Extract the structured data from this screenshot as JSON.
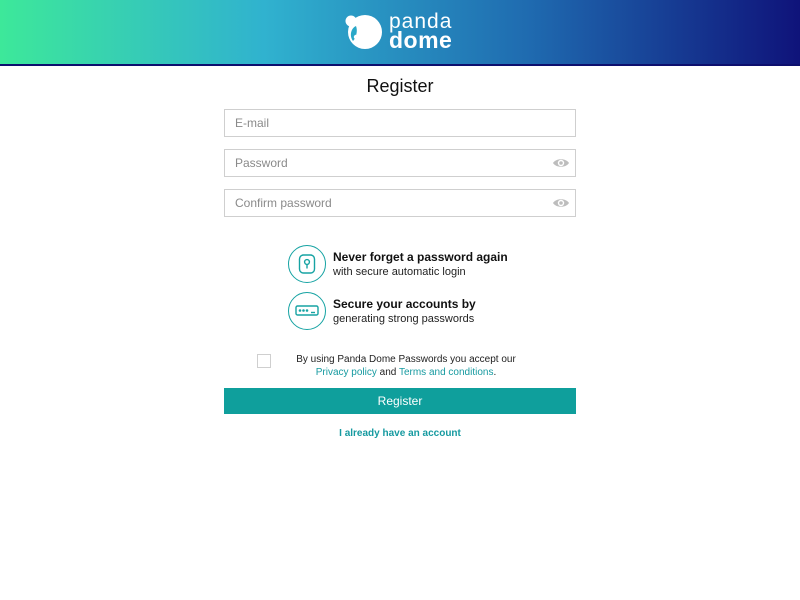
{
  "header": {
    "brand_top": "panda",
    "brand_bottom": "dome",
    "gradient": [
      "#3de89a",
      "#30b2cf",
      "#1f6bb0",
      "#0f137a"
    ]
  },
  "page": {
    "title": "Register"
  },
  "form": {
    "email": {
      "value": "",
      "placeholder": "E-mail"
    },
    "password": {
      "value": "",
      "placeholder": "Password",
      "toggle_icon": "eye-icon"
    },
    "confirm_password": {
      "value": "",
      "placeholder": "Confirm password",
      "toggle_icon": "eye-icon"
    }
  },
  "features": [
    {
      "icon": "lock-icon",
      "title": "Never forget a password again",
      "subtitle": "with secure automatic login"
    },
    {
      "icon": "password-field-icon",
      "title": "Secure your accounts by",
      "subtitle": "generating strong passwords"
    }
  ],
  "consent": {
    "checked": false,
    "text_before": "By using Panda Dome Passwords you accept our ",
    "privacy_link": "Privacy policy",
    "text_and": " and ",
    "terms_link": "Terms and conditions",
    "text_after": "."
  },
  "actions": {
    "register_label": "Register",
    "existing_account_label": "I already have an account"
  },
  "colors": {
    "accent": "#0f9f9c",
    "link": "#169aa0",
    "border": "#cfcfcf"
  }
}
